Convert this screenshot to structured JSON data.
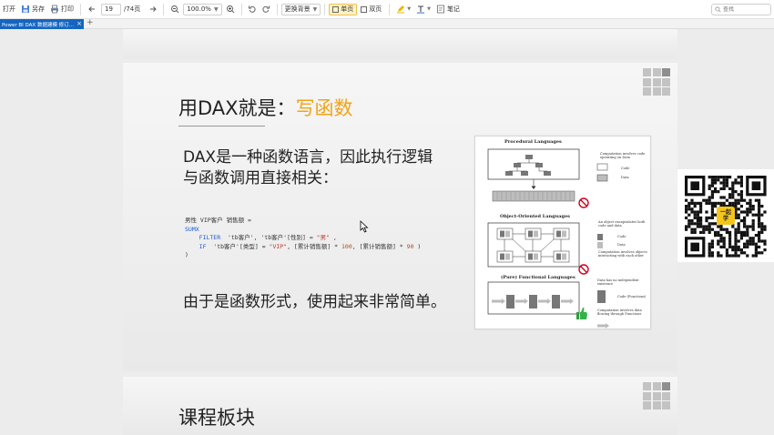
{
  "toolbar": {
    "open_label": "打开",
    "saveas_label": "另存",
    "print_label": "打印",
    "page_current": "19",
    "page_total": "/74页",
    "zoom_value": "100.0%",
    "bg_label": "更换背景",
    "single_page_label": "单页",
    "double_page_label": "双页",
    "note_label": "笔记",
    "search_placeholder": "查找"
  },
  "tabs": [
    {
      "title": "Power BI DAX 数据建模 修订…"
    }
  ],
  "slide1": {
    "title_plain": "用DAX就是：",
    "title_highlight": "写函数",
    "body_line1": "DAX是一种函数语言，因此执行逻辑",
    "body_line2": "与函数调用直接相关：",
    "code": {
      "measure_name": "男性 VIP客户 销售额 =",
      "func_sumx": "SUMX",
      "filter_kw": "FILTER",
      "filter_args_a": "  'tb客户', 'tb客户'[性别] = ",
      "filter_str": "\"男\"",
      "filter_end": " ,",
      "if_kw": "IF",
      "if_args_a": "  'tb客户'[类型] = ",
      "if_str": "\"VIP\"",
      "if_args_b": ", [累计销售额] * ",
      "if_num1": "100",
      "if_args_c": ", [累计销售额] * ",
      "if_num2": "90",
      "if_end": " )",
      "close": ")"
    },
    "conclusion": "由于是函数形式，使用起来非常简单。"
  },
  "figure": {
    "procedural_title": "Procedural Languages",
    "procedural_note": "Computation involves code operating on Data",
    "legend_code": "Code",
    "legend_data": "Data",
    "oo_title": "Object-Oriented Languages",
    "oo_note1": "An object encapsulates both code and data",
    "oo_legend_code": "Code",
    "oo_legend_data": "Data",
    "oo_note2": "Computation involves objects interacting with each other",
    "functional_title": "(Pure) Functional Languages",
    "functional_note1": "Data has no independent existence",
    "functional_legend_code": "Code (Functions)",
    "functional_note2": "Computation involves data flowing through Functions"
  },
  "slide2": {
    "title": "课程板块"
  },
  "qr": {
    "badge_line1": "一起",
    "badge_line2": "学"
  },
  "colors": {
    "accent": "#f0a419",
    "tab_active": "#1565c0",
    "code_keyword": "#1e5bd6",
    "code_string": "#c0392b"
  }
}
